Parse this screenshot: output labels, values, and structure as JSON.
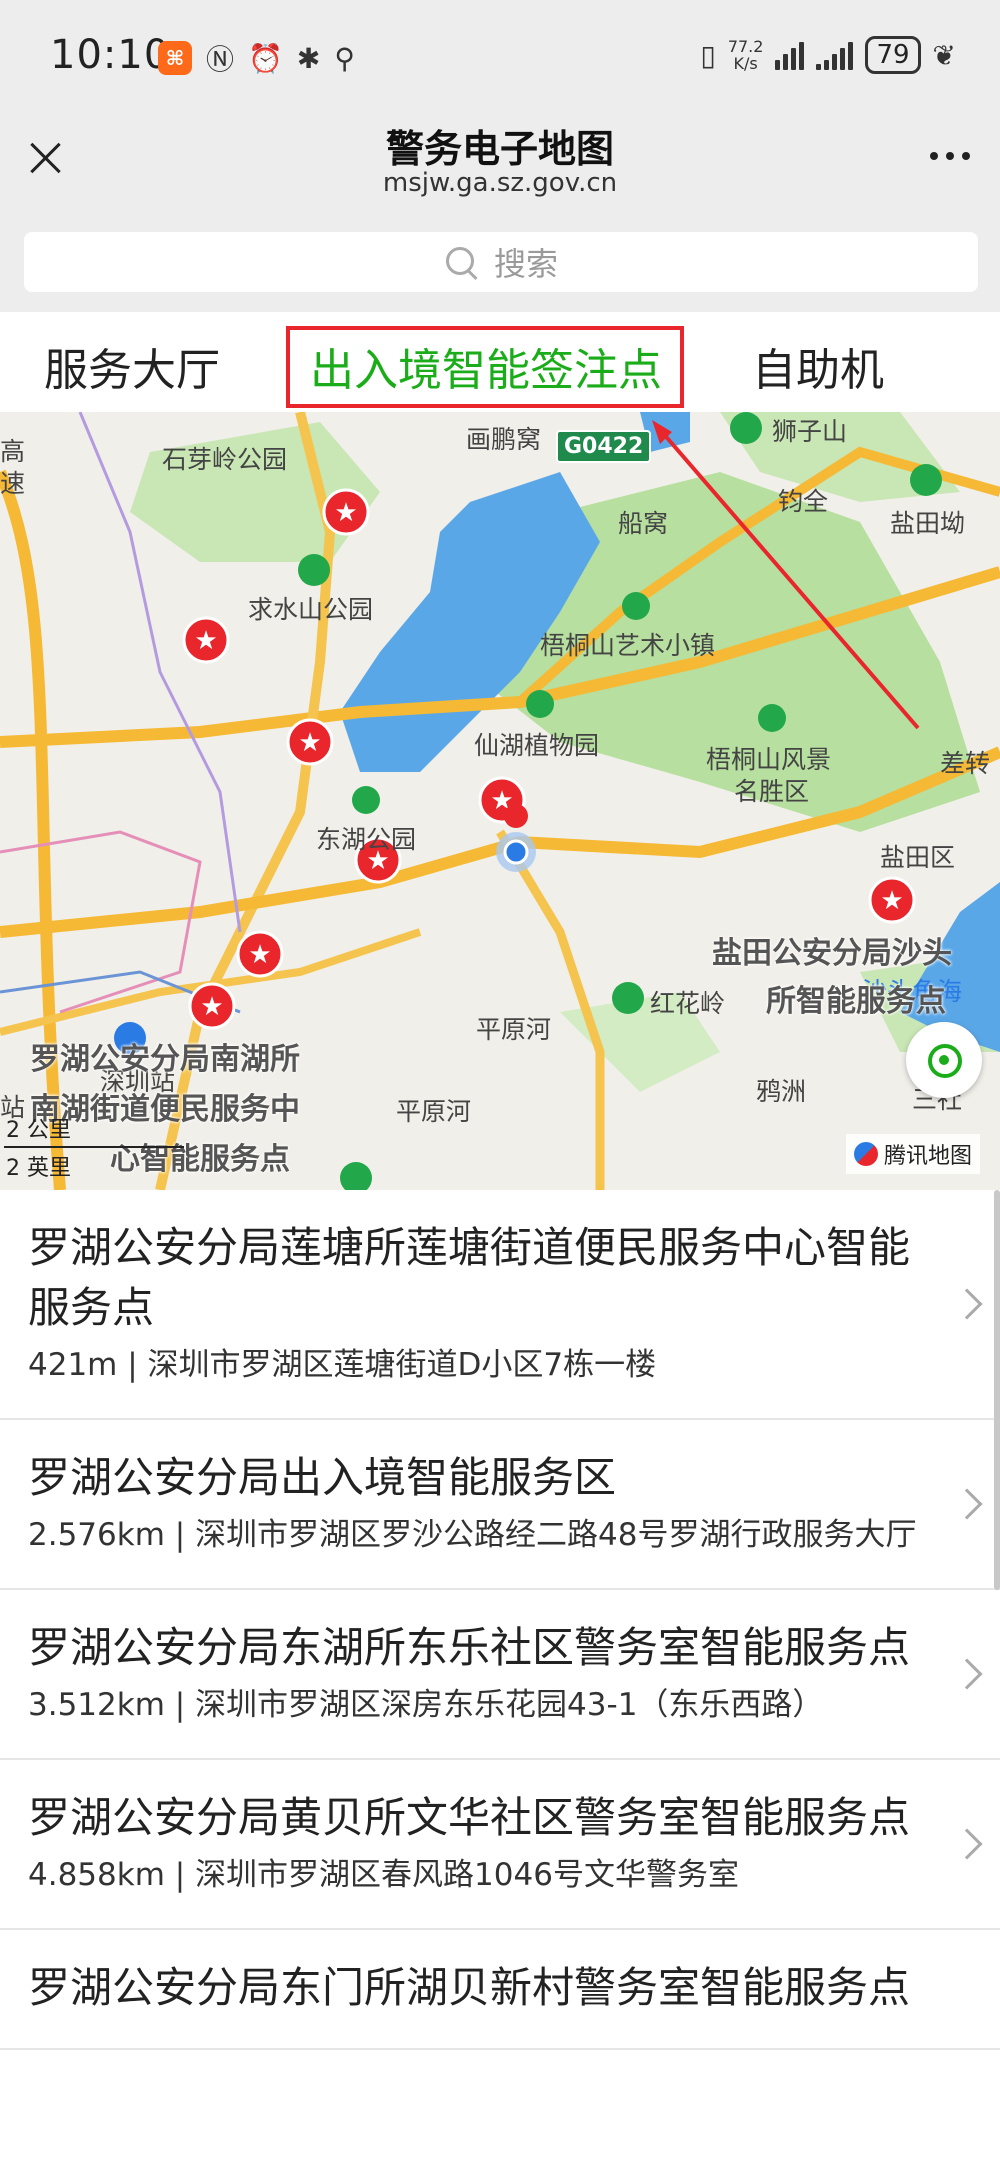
{
  "status_bar": {
    "time": "10:10",
    "speed_value": "77.2",
    "speed_unit": "K/s",
    "battery": "79",
    "icons": [
      "app-icon",
      "nfc-icon",
      "alarm-icon",
      "bluetooth-icon",
      "location-icon",
      "vibrate-icon",
      "signal-icon",
      "signal-icon-2",
      "leaf-icon"
    ]
  },
  "header": {
    "title": "警务电子地图",
    "subtitle": "msjw.ga.sz.gov.cn"
  },
  "search": {
    "placeholder": "搜索"
  },
  "tabs": [
    {
      "label": "服务大厅",
      "active": false
    },
    {
      "label": "出入境智能签注点",
      "active": true
    },
    {
      "label": "自助机",
      "active": false
    }
  ],
  "map": {
    "road_badge": "G0422",
    "labels": {
      "shiyaling": "石芽岭公园",
      "huapengwo": "画鹏窝",
      "shizishan": "狮子山",
      "chuanwo": "船窝",
      "junquan": "钧全",
      "yantianao": "盐田坳",
      "qiushuishan": "求水山公园",
      "wutongshan_town": "梧桐山艺术小镇",
      "xianhu": "仙湖植物园",
      "wutongshan_scenic_1": "梧桐山风景",
      "wutongshan_scenic_2": "名胜区",
      "chazhuan": "差转",
      "donghu": "东湖公园",
      "yantianqu": "盐田区",
      "honghualing": "红花岭",
      "pingyuanhe_1": "平原河",
      "pingyuanhe_2": "平原河",
      "yazhou": "鸦洲",
      "shatoujiao": "沙头角海",
      "shenzhen_station": "深圳站",
      "edge_gao": "高",
      "edge_su": "速",
      "edge_zhan": "站",
      "sanjie": "三社"
    },
    "poi_labels": {
      "yantian_1": "盐田公安分局沙头",
      "yantian_2": "所智能服务点",
      "nanhu_1": "罗湖公安分局南湖所",
      "nanhu_2": "南湖街道便民服务中",
      "nanhu_3": "心智能服务点"
    },
    "scale_metric": "2 公里",
    "scale_imperial": "2 英里",
    "attribution": "腾讯地图",
    "accent": "#1aad19",
    "marker_color": "#e8262c"
  },
  "results": [
    {
      "name": "罗湖公安分局莲塘所莲塘街道便民服务中心智能服务点",
      "distance": "421m",
      "address": "深圳市罗湖区莲塘街道D小区7栋一楼"
    },
    {
      "name": "罗湖公安分局出入境智能服务区",
      "distance": "2.576km",
      "address": "深圳市罗湖区罗沙公路经二路48号罗湖行政服务大厅"
    },
    {
      "name": "罗湖公安分局东湖所东乐社区警务室智能服务点",
      "distance": "3.512km",
      "address": "深圳市罗湖区深房东乐花园43-1（东乐西路）"
    },
    {
      "name": "罗湖公安分局黄贝所文华社区警务室智能服务点",
      "distance": "4.858km",
      "address": "深圳市罗湖区春风路1046号文华警务室"
    },
    {
      "name": "罗湖公安分局东门所湖贝新村警务室智能服务点",
      "distance": "",
      "address": ""
    }
  ]
}
